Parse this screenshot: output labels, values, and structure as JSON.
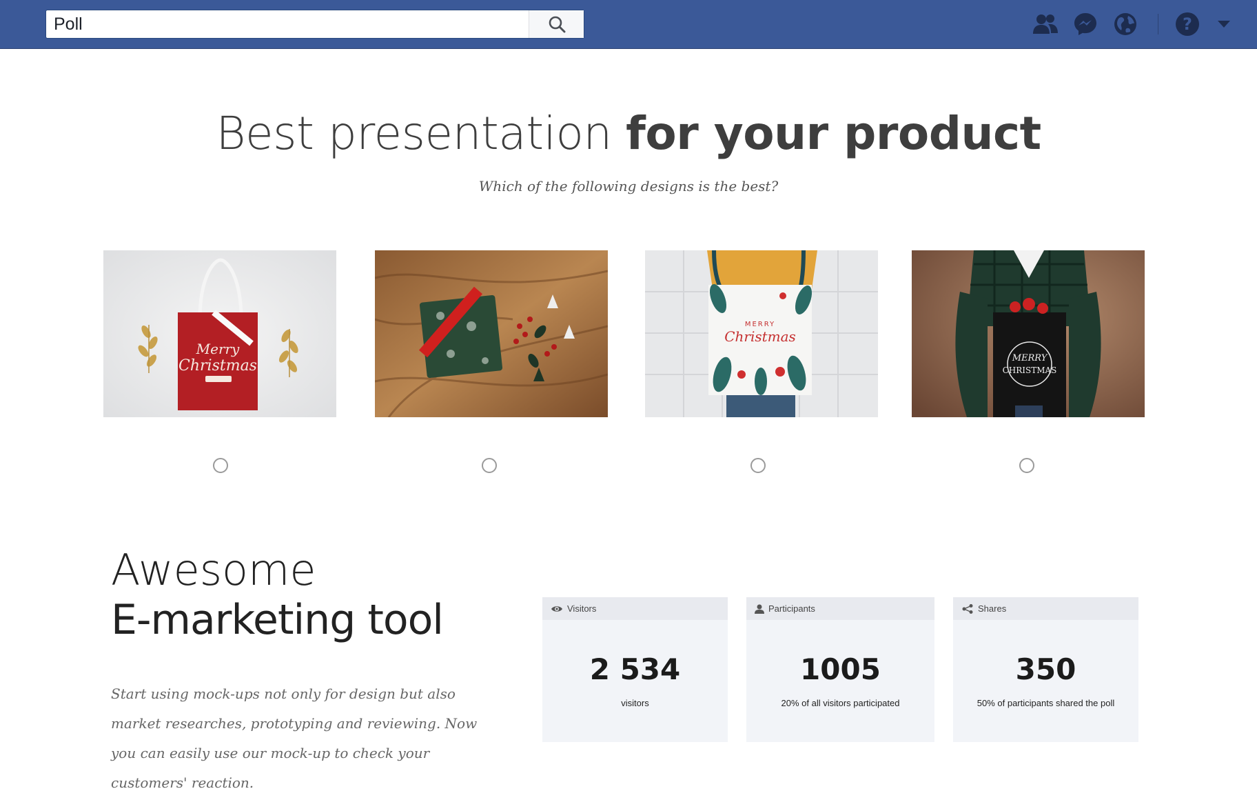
{
  "topbar": {
    "search_value": "Poll",
    "icons": [
      "search-icon",
      "friends-icon",
      "messenger-icon",
      "notifications-globe-icon",
      "help-icon",
      "dropdown-caret-icon"
    ],
    "brand_color": "#3b5998"
  },
  "hero": {
    "title_light": "Best presentation ",
    "title_bold": "for your product",
    "subtitle": "Which of the following designs is the best?"
  },
  "poll": {
    "options": [
      {
        "image": "red gift bag on snow with gold leaves",
        "bag_text": "Merry Christmas",
        "selected": false
      },
      {
        "image": "green wrapped gift with red ribbon on wood with berries",
        "selected": false
      },
      {
        "image": "white floral tote bag held against tiled wall",
        "bag_text": "MERRY Christmas",
        "selected": false
      },
      {
        "image": "black tote bag held by person in plaid shirt",
        "bag_text": "MERRY CHRISTMAS",
        "selected": false
      }
    ]
  },
  "marketing": {
    "heading_line1": "Awesome",
    "heading_line2": "E-marketing tool",
    "description": "Start using mock-ups not only for design but also market researches, prototyping and reviewing. Now you can easily use our mock-up to check your customers' reaction."
  },
  "stats": [
    {
      "label": "Visitors",
      "icon": "eye-icon",
      "value": "2 534",
      "caption": "visitors"
    },
    {
      "label": "Participants",
      "icon": "person-icon",
      "value": "1005",
      "caption": "20% of all visitors participated"
    },
    {
      "label": "Shares",
      "icon": "share-icon",
      "value": "350",
      "caption": "50% of participants shared the poll"
    }
  ]
}
